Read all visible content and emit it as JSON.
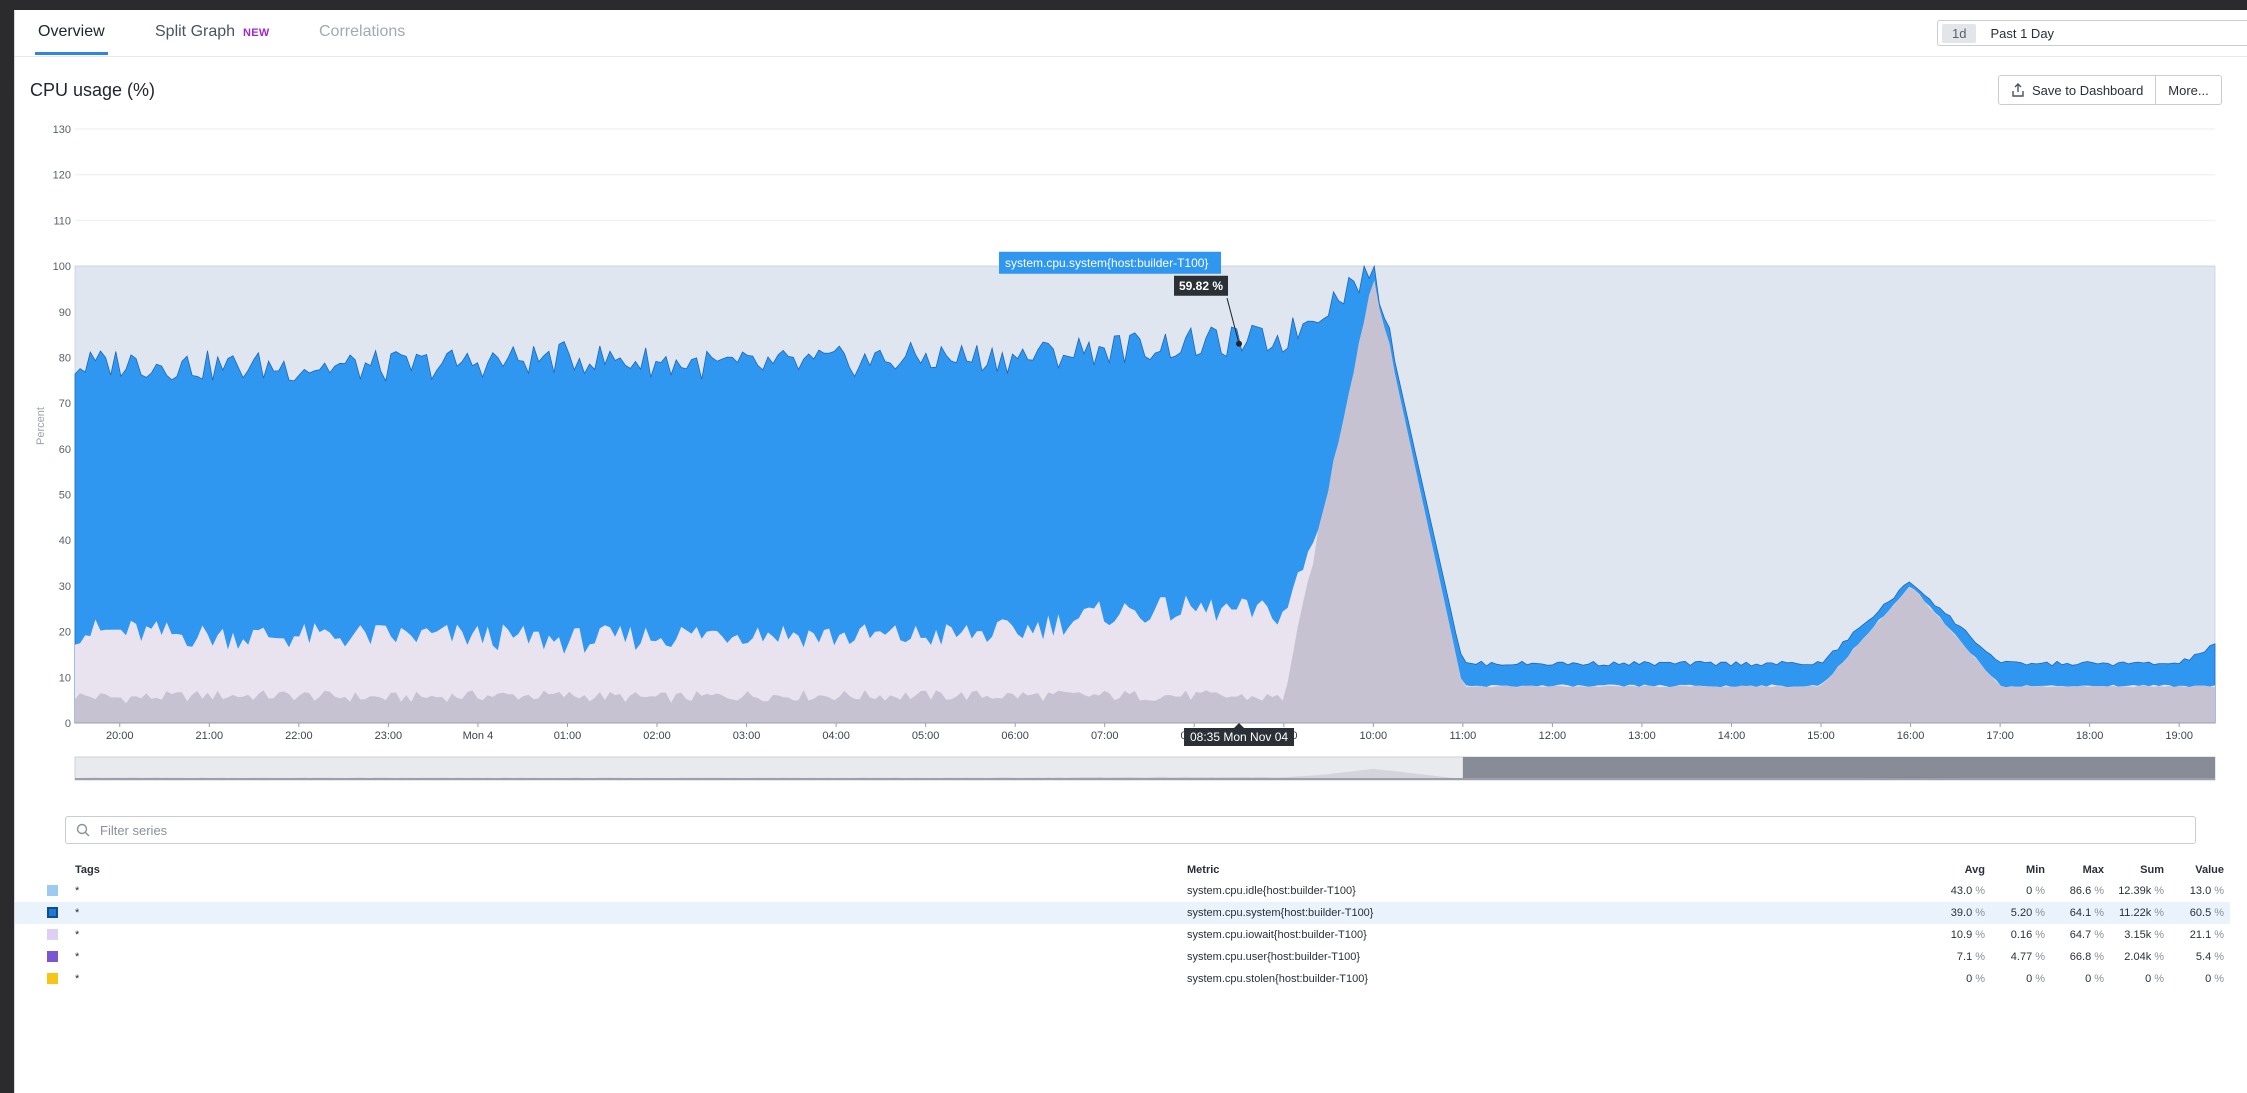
{
  "tabs": [
    {
      "label": "Overview",
      "state": "active"
    },
    {
      "label": "Split Graph",
      "badge": "NEW",
      "state": "normal"
    },
    {
      "label": "Correlations",
      "state": "disabled"
    }
  ],
  "time_picker": {
    "chip": "1d",
    "label": "Past 1 Day"
  },
  "widget": {
    "title": "CPU usage (%)",
    "save_label": "Save to Dashboard",
    "more_label": "More..."
  },
  "colors": {
    "accent": "#2e86de",
    "system": "#2f97f0",
    "system_stroke": "#1e66b8",
    "iowait": "#e8e3ee",
    "user_low": "#c6c2d2",
    "idle_bg": "#dfe6ef",
    "badge": "#a029c9"
  },
  "chart_data": {
    "type": "area",
    "ylabel": "Percent",
    "ylim": [
      0,
      130
    ],
    "yticks": [
      0,
      10,
      20,
      30,
      40,
      50,
      60,
      70,
      80,
      90,
      100,
      110,
      120,
      130
    ],
    "xticks": [
      "20:00",
      "21:00",
      "22:00",
      "23:00",
      "Mon 4",
      "01:00",
      "02:00",
      "03:00",
      "04:00",
      "05:00",
      "06:00",
      "07:00",
      "08:00",
      "09:00",
      "10:00",
      "11:00",
      "12:00",
      "13:00",
      "14:00",
      "15:00",
      "16:00",
      "17:00",
      "18:00",
      "19:00"
    ],
    "x_hours": [
      19.5,
      20,
      21,
      22,
      23,
      24,
      25,
      26,
      27,
      28,
      29,
      30,
      31,
      32,
      33,
      34,
      35,
      36,
      37,
      38,
      39,
      40,
      41,
      42,
      43,
      43.4
    ],
    "series": [
      {
        "name": "system.cpu.user{host:builder-T100}",
        "top": [
          6,
          5.5,
          6,
          6,
          5.5,
          6,
          6,
          5.5,
          6,
          6,
          6,
          6,
          6,
          6,
          5.5,
          98,
          8,
          8,
          8,
          8,
          8,
          30,
          8,
          8,
          8,
          8
        ]
      },
      {
        "name": "system.cpu.iowait{host:builder-T100}",
        "top": [
          20,
          20,
          19,
          19,
          19,
          19,
          18,
          19,
          20,
          19,
          19,
          20,
          24,
          25,
          24,
          70,
          8,
          8,
          8,
          8,
          8,
          30,
          8,
          8,
          8,
          8
        ]
      },
      {
        "name": "system.cpu.system{host:builder-T100}",
        "top": [
          78,
          79,
          78,
          78,
          78,
          79,
          80,
          79,
          78,
          79,
          80,
          80,
          82,
          83,
          84,
          100,
          13,
          13,
          13,
          13,
          13,
          31,
          13,
          13,
          13,
          17
        ]
      },
      {
        "name": "system.cpu.idle{host:builder-T100}",
        "top": [
          100,
          100,
          100,
          100,
          100,
          100,
          100,
          100,
          100,
          100,
          100,
          100,
          100,
          100,
          100,
          100,
          100,
          100,
          100,
          100,
          100,
          100,
          100,
          100,
          100,
          100
        ]
      }
    ],
    "tooltip": {
      "series": "system.cpu.system{host:builder-T100}",
      "value": "59.82 %",
      "x_hour": 32.5,
      "y": 83
    },
    "crosshair_label": "08:35 Mon Nov 04",
    "grid": true
  },
  "filter": {
    "placeholder": "Filter series"
  },
  "legend": {
    "headers": {
      "tags": "Tags",
      "metric": "Metric",
      "avg": "Avg",
      "min": "Min",
      "max": "Max",
      "sum": "Sum",
      "value": "Value"
    },
    "rows": [
      {
        "color": "#9ccaf0",
        "tags": "*",
        "metric": "system.cpu.idle{host:builder-T100}",
        "avg": "43.0",
        "min": "0",
        "max": "86.6",
        "sum": "12.39k",
        "value": "13.0",
        "unit": "%"
      },
      {
        "color": "#1f78d1",
        "tags": "*",
        "metric": "system.cpu.system{host:builder-T100}",
        "avg": "39.0",
        "min": "5.20",
        "max": "64.1",
        "sum": "11.22k",
        "value": "60.5",
        "unit": "%",
        "highlight": true
      },
      {
        "color": "#ddd0f3",
        "tags": "*",
        "metric": "system.cpu.iowait{host:builder-T100}",
        "avg": "10.9",
        "min": "0.16",
        "max": "64.7",
        "sum": "3.15k",
        "value": "21.1",
        "unit": "%"
      },
      {
        "color": "#7a57d1",
        "tags": "*",
        "metric": "system.cpu.user{host:builder-T100}",
        "avg": "7.1",
        "min": "4.77",
        "max": "66.8",
        "sum": "2.04k",
        "value": "5.4",
        "unit": "%"
      },
      {
        "color": "#f5c518",
        "tags": "*",
        "metric": "system.cpu.stolen{host:builder-T100}",
        "avg": "0",
        "min": "0",
        "max": "0",
        "sum": "0",
        "value": "0",
        "unit": "%"
      }
    ]
  }
}
